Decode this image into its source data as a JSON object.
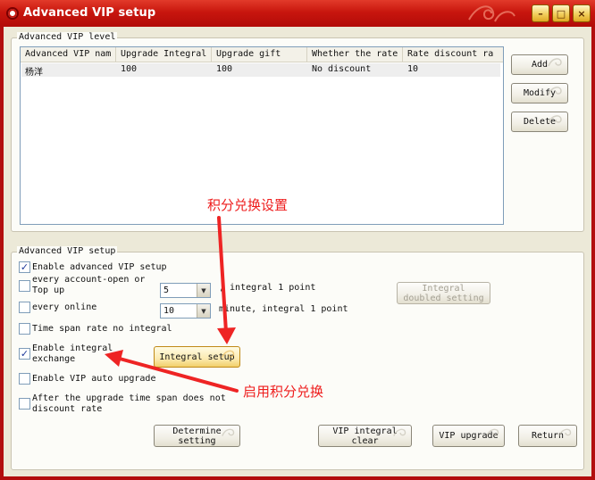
{
  "window": {
    "title": "Advanced VIP setup",
    "accent": "#c8160e",
    "buttons": [
      "minimize",
      "maximize",
      "close"
    ]
  },
  "vip_level": {
    "group_label": "Advanced VIP level",
    "columns": [
      "Advanced VIP nam",
      "Upgrade Integral",
      "Upgrade gift",
      "Whether the rate",
      "Rate discount ra"
    ],
    "rows": [
      [
        "杨洋",
        "100",
        "100",
        "No discount",
        "10"
      ]
    ],
    "buttons": {
      "add": "Add",
      "modify": "Modify",
      "delete": "Delete"
    }
  },
  "vip_setup": {
    "group_label": "Advanced VIP setup",
    "enable_advanced": {
      "label": "Enable advanced VIP setup",
      "checked": true
    },
    "account_open": {
      "label_line1": "every account-open or",
      "label_line2": "Top up",
      "checked": false,
      "value": "5",
      "suffix": ", integral 1 point"
    },
    "online": {
      "label": "every online",
      "checked": false,
      "value": "10",
      "suffix": "minute, integral 1 point"
    },
    "time_span": {
      "label": "Time span rate no integral",
      "checked": false
    },
    "enable_exchange": {
      "label_line1": "Enable integral",
      "label_line2": "exchange",
      "checked": true
    },
    "integral_setup_button": "Integral setup",
    "doubled_setting_button_line1": "Integral",
    "doubled_setting_button_line2": "doubled setting",
    "auto_upgrade": {
      "label": "Enable VIP auto upgrade",
      "checked": false
    },
    "after_upgrade": {
      "label_line1": "After the upgrade time span does not",
      "label_line2": "discount rate",
      "checked": false
    }
  },
  "footer": {
    "determine_line1": "Determine",
    "determine_line2": "setting",
    "vip_clear_line1": "VIP integral",
    "vip_clear_line2": "clear",
    "vip_upgrade": "VIP upgrade",
    "return": "Return"
  },
  "annotations": {
    "integral_setup_note": "积分兑换设置",
    "enable_exchange_note": "启用积分兑换",
    "color": "#ee1c1c"
  }
}
